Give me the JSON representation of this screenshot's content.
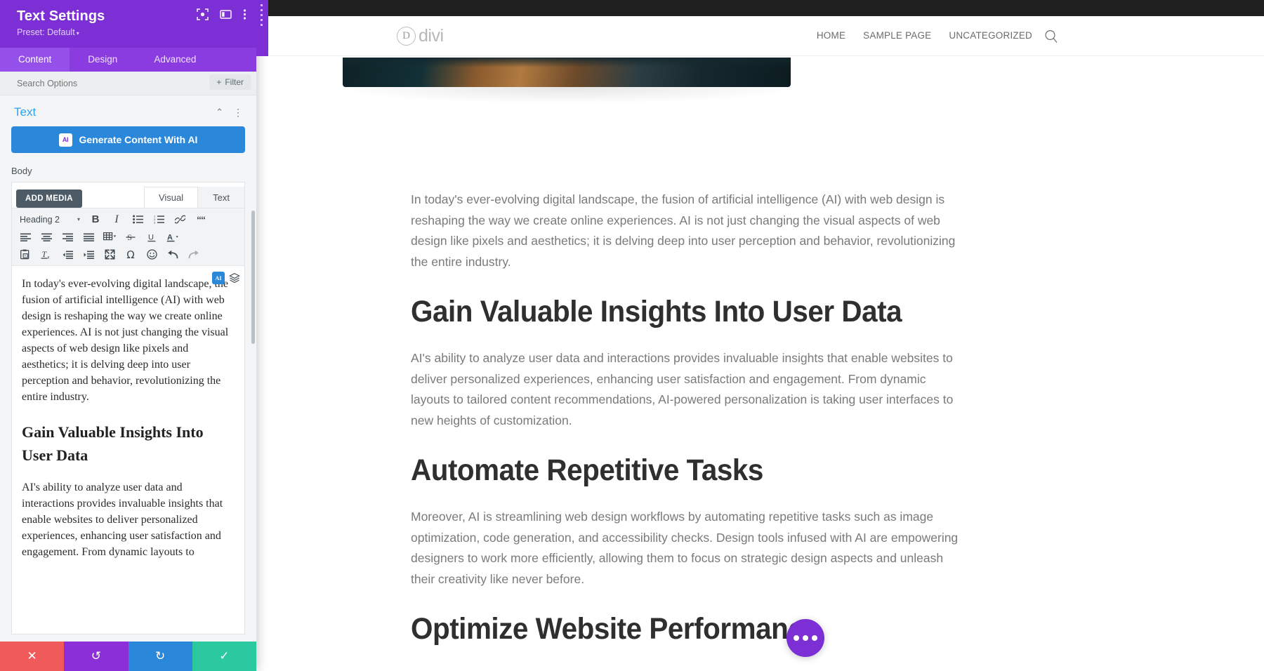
{
  "panel": {
    "title": "Text Settings",
    "preset": "Preset: Default",
    "preset_caret": "▾",
    "head_icons": [
      "focus-frame-icon",
      "layout-panel-icon",
      "more-vertical-icon"
    ],
    "tabs": [
      {
        "label": "Content",
        "active": true
      },
      {
        "label": "Design",
        "active": false
      },
      {
        "label": "Advanced",
        "active": false
      }
    ],
    "search": {
      "placeholder": "Search Options",
      "value": ""
    },
    "filter_button": {
      "label": "Filter",
      "plus": "+"
    },
    "section": {
      "title": "Text",
      "collapse_caret": "⌃",
      "more_dots": "⋮"
    },
    "ai_button": {
      "badge": "AI",
      "label": "Generate Content With AI"
    },
    "body_label": "Body",
    "editor": {
      "add_media": "ADD MEDIA",
      "tabs": [
        {
          "label": "Visual",
          "active": true
        },
        {
          "label": "Text",
          "active": false
        }
      ],
      "format_select": {
        "value": "Heading 2",
        "caret": "▾"
      },
      "toolbar_row1": [
        "bold-icon",
        "italic-icon",
        "bulleted-list-icon",
        "numbered-list-icon",
        "link-icon",
        "blockquote-icon"
      ],
      "toolbar_row2": [
        "align-left-icon",
        "align-center-icon",
        "align-right-icon",
        "align-justify-icon",
        "table-icon",
        "strikethrough-icon",
        "underline-icon",
        "text-color-icon"
      ],
      "toolbar_row3": [
        "paste-as-text-icon",
        "clear-formatting-icon",
        "outdent-icon",
        "indent-icon",
        "fullscreen-icon",
        "special-character-icon",
        "emoji-icon",
        "undo-icon",
        "redo-icon"
      ],
      "floating": {
        "ai_badge": "AI",
        "layers_icon": "layers-icon"
      },
      "content": {
        "p1": "In today's ever-evolving digital landscape, the fusion of artificial intelligence (AI) with web design is reshaping the way we create online experiences. AI is not just changing the visual aspects of web design like pixels and aesthetics; it is delving deep into user perception and behavior, revolutionizing the entire industry.",
        "h2_1": "Gain Valuable Insights Into User Data",
        "p2": "AI's ability to analyze user data and interactions provides invaluable insights that enable websites to deliver personalized experiences, enhancing user satisfaction and engagement. From dynamic layouts to"
      }
    },
    "action_bar": {
      "cancel": "✕",
      "undo": "↺",
      "redo": "↻",
      "save": "✓"
    }
  },
  "site": {
    "logo": {
      "mark": "D",
      "text": "divi"
    },
    "nav": [
      "HOME",
      "SAMPLE PAGE",
      "UNCATEGORIZED"
    ],
    "search_icon": "search-icon",
    "content": {
      "p1": "In today's ever-evolving digital landscape, the fusion of artificial intelligence (AI) with web design is reshaping the way we create online experiences. AI is not just changing the visual aspects of web design like pixels and aesthetics; it is delving deep into user perception and behavior, revolutionizing the entire industry.",
      "h2_1": "Gain Valuable Insights Into User Data",
      "p2": "AI's ability to analyze user data and interactions provides invaluable insights that enable websites to deliver personalized experiences, enhancing user satisfaction and engagement. From dynamic layouts to tailored content recommendations, AI-powered personalization is taking user interfaces to new heights of customization.",
      "h2_2": "Automate Repetitive Tasks",
      "p3": "Moreover, AI is streamlining web design workflows by automating repetitive tasks such as image optimization, code generation, and accessibility checks. Design tools infused with AI are empowering designers to work more efficiently, allowing them to focus on strategic design aspects and unleash their creativity like never before.",
      "h2_3": "Optimize Website Performance"
    },
    "chat_fab": "chat-bubble-icon"
  },
  "colors": {
    "panel_header": "#7b2fd4",
    "panel_tabs": "#8a3ce0",
    "accent_blue": "#2ea3f2",
    "ai_button": "#2b87da",
    "cancel_red": "#f05a5a",
    "undo_purple": "#8b2fd8",
    "redo_blue": "#2b87da",
    "save_green": "#2cc9a0",
    "chat_fab": "#7b2fd4"
  }
}
